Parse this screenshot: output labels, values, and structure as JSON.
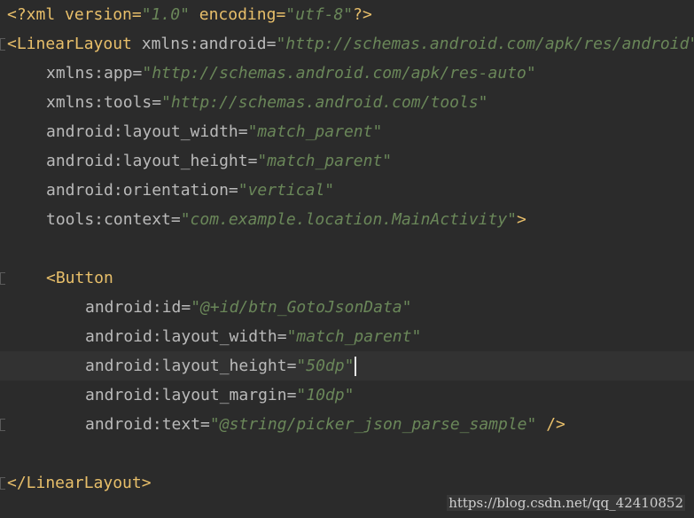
{
  "editor": {
    "lines": [
      {
        "t1": "<?xml version=",
        "v1": "\"1.0\"",
        "t2": " encoding=",
        "v2": "\"utf-8\"",
        "t3": "?>"
      },
      {
        "tag": "<LinearLayout",
        "attr": " xmlns:android=",
        "val": "\"http://schemas.android.com/apk/res/android\""
      },
      {
        "attr": "xmlns:app=",
        "val": "\"http://schemas.android.com/apk/res-auto\""
      },
      {
        "attr": "xmlns:tools=",
        "val": "\"http://schemas.android.com/tools\""
      },
      {
        "attr": "android:layout_width=",
        "val": "\"match_parent\""
      },
      {
        "attr": "android:layout_height=",
        "val": "\"match_parent\""
      },
      {
        "attr": "android:orientation=",
        "val": "\"vertical\""
      },
      {
        "attr": "tools:context=",
        "val": "\"com.example.location.MainActivity\"",
        "end": ">"
      },
      {},
      {
        "tag": "<Button"
      },
      {
        "attr": "android:id=",
        "val": "\"@+id/btn_GotoJsonData\""
      },
      {
        "attr": "android:layout_width=",
        "val": "\"match_parent\""
      },
      {
        "attr": "android:layout_height=",
        "val": "\"50dp\""
      },
      {
        "attr": "android:layout_margin=",
        "val": "\"10dp\""
      },
      {
        "attr": "android:text=",
        "val": "\"@string/picker_json_parse_sample\"",
        "end": " />"
      },
      {},
      {
        "tag": "</LinearLayout>"
      }
    ]
  },
  "watermark": "https://blog.csdn.net/qq_42410852"
}
